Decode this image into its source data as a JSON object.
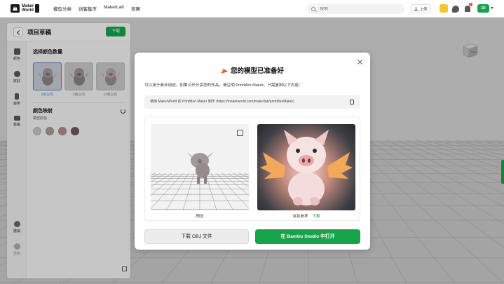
{
  "brand": {
    "line1": "Maker",
    "line2": "World"
  },
  "nav": [
    "模型分类",
    "创客集市",
    "MakerLab",
    "竞赛"
  ],
  "search": {
    "placeholder": "搜索"
  },
  "header_actions": {
    "upload_label": "上传",
    "notification_count": "1",
    "avatar_text": "3D"
  },
  "panel": {
    "title": "项目草稿",
    "download_label": "下载",
    "rail": [
      "颜色",
      "皮肤",
      "姿势",
      "装备"
    ],
    "bottom_rail": [
      "撤销",
      "重做"
    ],
    "section_palette": "选择颜色数量",
    "thumbs": [
      {
        "label": "8色以内",
        "selected": true
      },
      {
        "label": "4色以内",
        "selected": false
      },
      {
        "label": "12色以内",
        "selected": false
      }
    ],
    "color_section": "颜色映射",
    "color_sub": "模型颜色",
    "swatches": [
      "#c6c6c6",
      "#a89a96",
      "#b48c8c",
      "#6e585e"
    ]
  },
  "modal": {
    "title": "您的模型已准备好",
    "description": "可以用于商业用途。如果公开分享您的作品，请注明 PrintMon Maker。只需复制以下内容：",
    "attribution": "使用 MakerWorld 的 PrintMon Maker 制作 (https://makerworld.com/makerlab/printMonMaker)",
    "preview_label": "预览",
    "reference_label": "涂色参考",
    "reference_download": "下载",
    "btn_obj": "下载 OBJ 文件",
    "btn_studio": "在 Bambu Studio 中打开"
  },
  "colors": {
    "accent": "#16a34a",
    "selection": "#4a86d0"
  }
}
